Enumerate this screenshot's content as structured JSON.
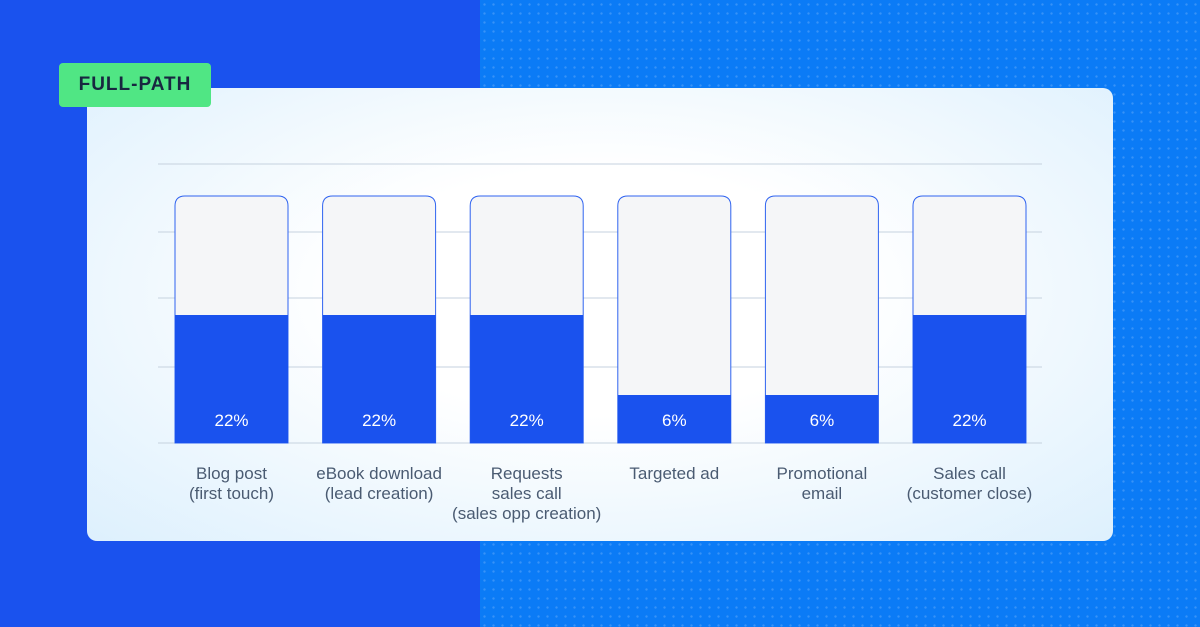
{
  "badge": "FULL-PATH",
  "colors": {
    "bar_fill": "#1a52ee",
    "bar_empty": "#f5f6f8",
    "badge": "#50e684"
  },
  "chart_data": {
    "type": "bar",
    "categories": [
      [
        "Blog post",
        "(first touch)"
      ],
      [
        "eBook download",
        "(lead creation)"
      ],
      [
        "Requests",
        "sales call",
        "(sales opp creation)"
      ],
      [
        "Targeted ad"
      ],
      [
        "Promotional",
        "email"
      ],
      [
        "Sales call",
        "(customer close)"
      ]
    ],
    "values": [
      22,
      22,
      22,
      6,
      6,
      22
    ],
    "data_labels": [
      "22%",
      "22%",
      "22%",
      "6%",
      "6%",
      "22%"
    ],
    "grid": true
  }
}
